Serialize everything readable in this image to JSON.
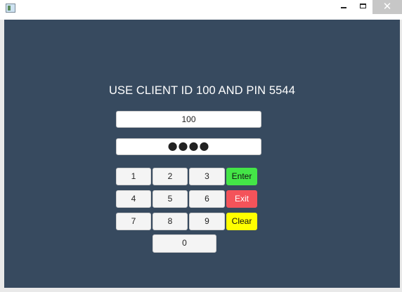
{
  "window": {
    "icon": "app-window-icon",
    "minimize_icon": "minimize-icon",
    "maximize_icon": "maximize-icon",
    "close_glyph": "✕"
  },
  "instruction": "USE CLIENT ID 100 AND PIN 5544",
  "client_id": {
    "value": "100"
  },
  "pin": {
    "masked_value": "●●●●"
  },
  "keypad": {
    "k1": "1",
    "k2": "2",
    "k3": "3",
    "k4": "4",
    "k5": "5",
    "k6": "6",
    "k7": "7",
    "k8": "8",
    "k9": "9",
    "k0": "0",
    "enter": "Enter",
    "exit": "Exit",
    "clear": "Clear"
  },
  "colors": {
    "background": "#374a5f",
    "enter": "#44e547",
    "exit": "#f4535a",
    "clear": "#ffff00"
  }
}
